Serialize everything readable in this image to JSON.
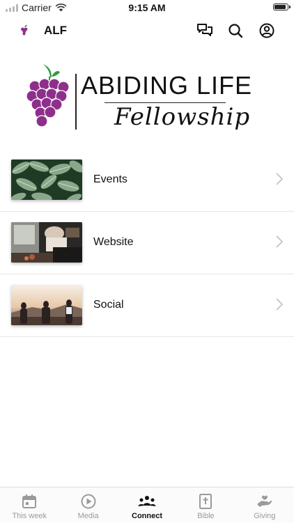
{
  "status_bar": {
    "carrier": "Carrier",
    "time": "9:15 AM",
    "battery_level": 0.85
  },
  "header": {
    "app_name": "ALF",
    "icons": [
      "chat-icon",
      "search-icon",
      "account-icon"
    ]
  },
  "brand": {
    "title": "ABIDING LIFE",
    "subtitle": "Fellowship"
  },
  "list": {
    "items": [
      {
        "label": "Events",
        "thumb": "plant-leaves-photo"
      },
      {
        "label": "Website",
        "thumb": "people-at-table-photo"
      },
      {
        "label": "Social",
        "thumb": "friends-at-sunset-photo"
      }
    ]
  },
  "tabbar": {
    "active": "Connect",
    "tabs": [
      {
        "label": "This week",
        "icon": "calendar-icon"
      },
      {
        "label": "Media",
        "icon": "play-icon"
      },
      {
        "label": "Connect",
        "icon": "people-icon"
      },
      {
        "label": "Bible",
        "icon": "bible-icon"
      },
      {
        "label": "Giving",
        "icon": "giving-hand-icon"
      }
    ]
  },
  "colors": {
    "grape": "#8e2f8b",
    "leaf": "#2e9a3f",
    "text": "#111111",
    "inactive": "#9a9a9a",
    "divider": "#e6e6e6"
  }
}
